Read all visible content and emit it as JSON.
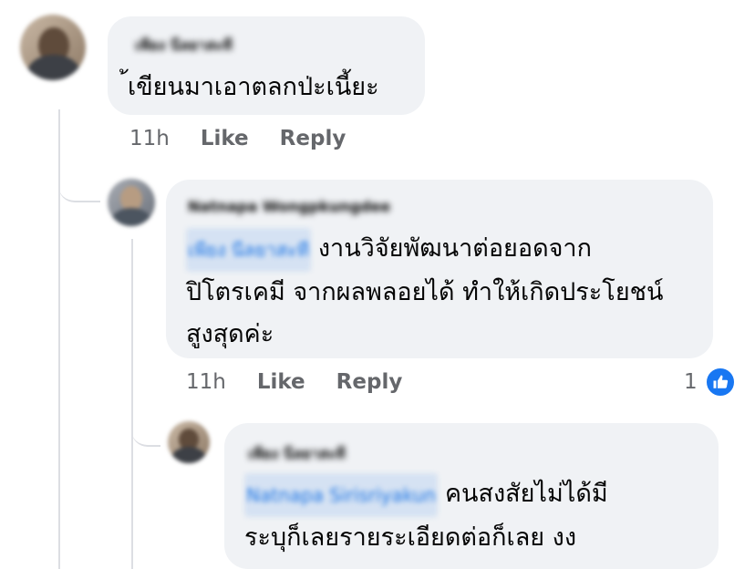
{
  "comments": [
    {
      "author": "เพียง นีลยาสะที",
      "text": "้เขียนมาเอาตลกป่ะเนี้ยะ",
      "time": "11h",
      "like_label": "Like",
      "reply_label": "Reply"
    },
    {
      "author": "Natnapa Wongpkungdee",
      "mention": "เพียง นีลยาสะที",
      "text_lines": [
        "งานวิจัยพัฒนาต่อยอดจาก",
        "ปิโตรเคมี จากผลพลอยได้ ทำให้เกิดประโยชน์",
        "สูงสุดค่ะ"
      ],
      "time": "11h",
      "like_label": "Like",
      "reply_label": "Reply",
      "reaction_count": "1"
    },
    {
      "author": "เพียง นีลยาสะที",
      "mention": "Natnapa Sirisriyakun",
      "text_lines": [
        "คนสงสัยไม่ได้มี",
        "ระบุก็เลยรายระเอียดต่อก็เลย งง"
      ]
    }
  ],
  "colors": {
    "bubble": "#f0f2f5",
    "meta_text": "#65676b",
    "mention": "#1b74e4",
    "like_blue": "#1877f2"
  },
  "icons": {
    "reaction": "thumbs-up-icon"
  }
}
